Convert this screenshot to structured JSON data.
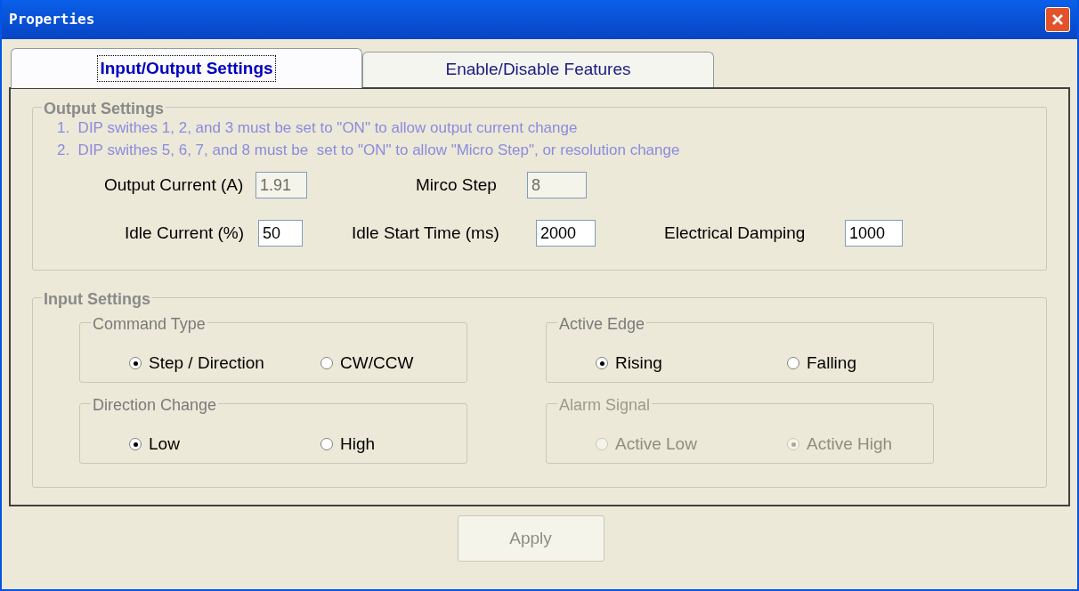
{
  "window": {
    "title": "Properties"
  },
  "tabs": [
    {
      "label": "Input/Output Settings",
      "selected": true
    },
    {
      "label": "Enable/Disable Features",
      "selected": false
    }
  ],
  "output_settings": {
    "title": "Output Settings",
    "notes": [
      "1.  DIP swithes 1, 2, and 3 must be set to \"ON\" to allow output current change",
      "2.  DIP swithes 5, 6, 7, and 8 must be  set to \"ON\" to allow \"Micro Step\", or resolution change"
    ],
    "rows": [
      [
        {
          "label": "Output Current (A)",
          "value": "1.91",
          "disabled": true
        },
        {
          "label": "Mirco Step",
          "value": "8",
          "disabled": true
        }
      ],
      [
        {
          "label": "Idle Current (%)",
          "value": "50",
          "disabled": false
        },
        {
          "label": "Idle Start Time (ms)",
          "value": "2000",
          "disabled": false
        },
        {
          "label": "Electrical Damping",
          "value": "1000",
          "disabled": false
        }
      ]
    ]
  },
  "input_settings": {
    "title": "Input Settings",
    "groups": [
      {
        "title": "Command Type",
        "disabled": false,
        "options": [
          {
            "label": "Step / Direction",
            "selected": true
          },
          {
            "label": "CW/CCW",
            "selected": false
          }
        ]
      },
      {
        "title": "Active Edge",
        "disabled": false,
        "options": [
          {
            "label": "Rising",
            "selected": true
          },
          {
            "label": "Falling",
            "selected": false
          }
        ]
      },
      {
        "title": "Direction Change",
        "disabled": false,
        "options": [
          {
            "label": "Low",
            "selected": true
          },
          {
            "label": "High",
            "selected": false
          }
        ]
      },
      {
        "title": "Alarm Signal",
        "disabled": true,
        "options": [
          {
            "label": "Active Low",
            "selected": false
          },
          {
            "label": "Active High",
            "selected": true
          }
        ]
      }
    ]
  },
  "apply_button": {
    "label": "Apply",
    "disabled": true
  }
}
